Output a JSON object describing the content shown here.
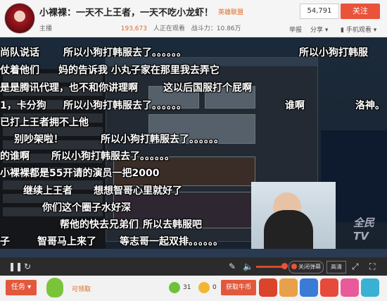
{
  "header": {
    "title": "小裸裸：一天不上王者，一天不吃小龙虾！",
    "tag": "英雄联盟",
    "host_label": "主播",
    "audience_count": "193,673",
    "audience_label": "人正在观看",
    "power_label": "战斗力：10.86万",
    "follow_count": "54,791",
    "follow_label": "关注",
    "report": "举报",
    "share": "分享",
    "mobile": "手机观看"
  },
  "danmaku": [
    "尚队说话",
    "所以小狗打韩服去了。。。。。。",
    "所以小狗打韩服",
    "仗着他们",
    "妈的告诉我 小丸子家在那里我去弄它",
    "是是腾讯代理，也不和你讲理啊",
    "这以后国服打个屁啊",
    "1，卡分狗",
    "所以小狗打韩服去了。。。。。。",
    "谁啊",
    "洛神。",
    "已打上王者拥不上他",
    "别吵架啦！",
    "所以小狗打韩服去了。。。。。。",
    "的谁啊",
    "所以小狗打韩服去了。。。。。。",
    "小裸裸都是55开请的演员一把2000",
    "继续上王者",
    "想想智哥心里就好了",
    "你们这个圈子水好深",
    "帮他的快去兄弟们",
    "所以去韩服吧",
    "子",
    "智哥马上来了",
    "等志哥一起双排。。。。。。"
  ],
  "controls": {
    "danmu_toggle": "关闭弹幕",
    "quality": "高清"
  },
  "bottom": {
    "task": "任务",
    "claim": "可领取",
    "apple_count": "31",
    "coin_count": "0",
    "get_coin": "获取牛币"
  },
  "watermark": "全民TV",
  "colors": {
    "accent": "#e8533a",
    "orange_text": "#e0661f"
  }
}
